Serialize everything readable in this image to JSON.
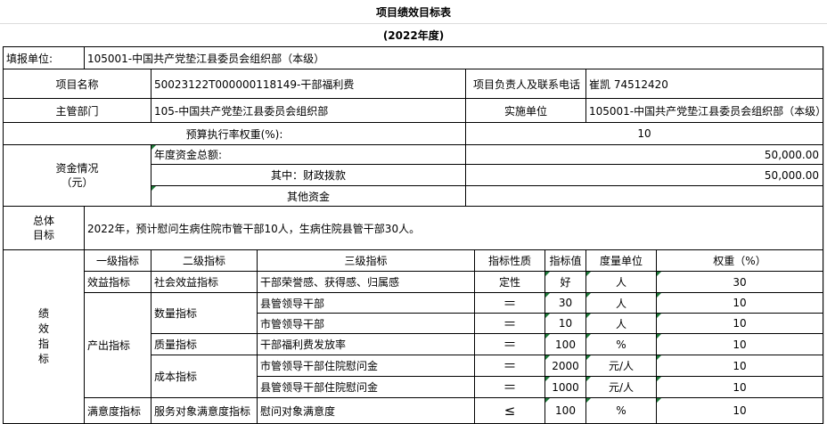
{
  "title": "项目绩效目标表",
  "year": "(2022年度)",
  "reporting_unit_label": "填报单位:",
  "reporting_unit_value": "105001-中国共产党垫江县委员会组织部（本级）",
  "project_name_label": "项目名称",
  "project_name_value": "50023122T000000118149-干部福利费",
  "responsible_label": "项目负责人及联系电话",
  "responsible_value": "崔凯 74512420",
  "dept_label": "主管部门",
  "dept_value": "105-中国共产党垫江县委员会组织部",
  "impl_label": "实施单位",
  "impl_value": "105001-中国共产党垫江县委员会组织部（本级）",
  "budget_weight_label": "预算执行率权重(%):",
  "budget_weight_value": "10",
  "funds_label": "资金情况\n（元）",
  "funds_total_label": "年度资金总额:",
  "funds_total_value": "50,000.00",
  "funds_fiscal_label": "其中：财政拨款",
  "funds_fiscal_value": "50,000.00",
  "funds_other_label": "其他资金",
  "funds_other_value": "",
  "goal_label": "总体\n目标",
  "goal_value": "2022年，预计慰问生病住院市管干部10人，生病住院县管干部30人。",
  "perf_label": "绩\n效\n指\n标",
  "headers": [
    "一级指标",
    "二级指标",
    "三级指标",
    "指标性质",
    "指标值",
    "度量单位",
    "权重（%）"
  ],
  "level1": [
    "效益指标",
    "产出指标",
    "满意度指标"
  ],
  "level2": [
    "社会效益指标",
    "数量指标",
    "质量指标",
    "成本指标",
    "服务对象满意度指标"
  ],
  "rows": [
    {
      "l3": "干部荣誉感、获得感、归属感",
      "nature": "定性",
      "value": "好",
      "unit": "人",
      "weight": "30"
    },
    {
      "l3": "县管领导干部",
      "nature": "＝",
      "value": "30",
      "unit": "人",
      "weight": "10"
    },
    {
      "l3": "市管领导干部",
      "nature": "＝",
      "value": "10",
      "unit": "人",
      "weight": "10"
    },
    {
      "l3": "干部福利费发放率",
      "nature": "＝",
      "value": "100",
      "unit": "%",
      "weight": "10"
    },
    {
      "l3": "市管领导干部住院慰问金",
      "nature": "＝",
      "value": "2000",
      "unit": "元/人",
      "weight": "10"
    },
    {
      "l3": "县管领导干部住院慰问金",
      "nature": "＝",
      "value": "1000",
      "unit": "元/人",
      "weight": "10"
    },
    {
      "l3": "慰问对象满意度",
      "nature": "≤",
      "value": "100",
      "unit": "%",
      "weight": "10"
    }
  ]
}
